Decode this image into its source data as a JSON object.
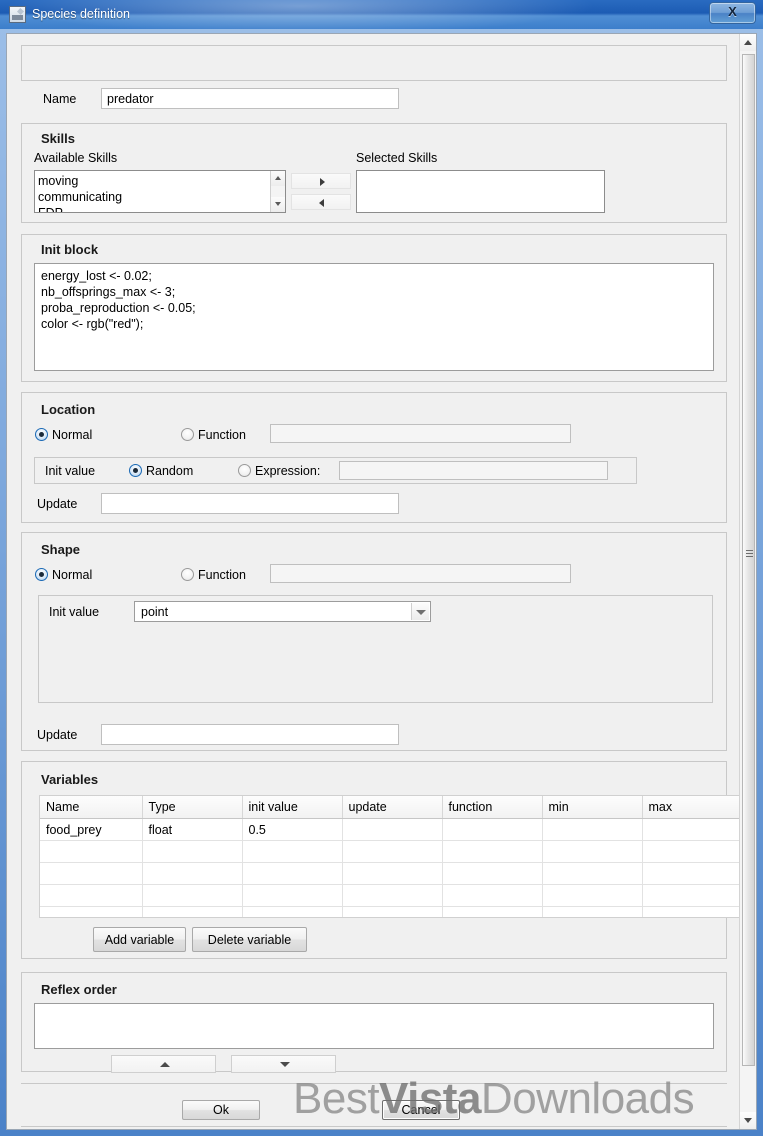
{
  "window": {
    "title": "Species definition",
    "icon": "app-image-icon",
    "close_label": "X",
    "titlebar_color": "#1d5cb4"
  },
  "name_row": {
    "label": "Name",
    "value": "predator"
  },
  "skills": {
    "group_title": "Skills",
    "available_label": "Available Skills",
    "selected_label": "Selected Skills",
    "available_items": [
      "moving",
      "communicating",
      "FDP"
    ],
    "selected_items": [],
    "add_arrow": "▶",
    "remove_arrow": "◀"
  },
  "init_block": {
    "group_title": "Init block",
    "code": "energy_lost <- 0.02;\nnb_offsprings_max <- 3;\nproba_reproduction <- 0.05;\ncolor <- rgb(\"red\");"
  },
  "location": {
    "group_title": "Location",
    "normal_label": "Normal",
    "function_label": "Function",
    "mode": "Normal",
    "function_value": "",
    "init_value_label": "Init value",
    "random_label": "Random",
    "expression_label": "Expression:",
    "init_mode": "Random",
    "expression_value": "",
    "update_label": "Update",
    "update_value": ""
  },
  "shape": {
    "group_title": "Shape",
    "normal_label": "Normal",
    "function_label": "Function",
    "mode": "Normal",
    "function_value": "",
    "init_value_label": "Init value",
    "init_value": "point",
    "init_value_options": [
      "point"
    ],
    "update_label": "Update",
    "update_value": ""
  },
  "variables": {
    "group_title": "Variables",
    "columns": [
      "Name",
      "Type",
      "init value",
      "update",
      "function",
      "min",
      "max"
    ],
    "rows": [
      [
        "food_prey",
        "float",
        "0.5",
        "",
        "",
        "",
        ""
      ],
      [
        "",
        "",
        "",
        "",
        "",
        "",
        ""
      ],
      [
        "",
        "",
        "",
        "",
        "",
        "",
        ""
      ],
      [
        "",
        "",
        "",
        "",
        "",
        "",
        ""
      ],
      [
        "",
        "",
        "",
        "",
        "",
        "",
        ""
      ]
    ],
    "add_button": "Add variable",
    "delete_button": "Delete variable"
  },
  "reflex_order": {
    "group_title": "Reflex order",
    "items": [],
    "move_up_icon": "triangle-up-icon",
    "move_down_icon": "triangle-down-icon"
  },
  "footer": {
    "ok_label": "Ok",
    "cancel_label": "Cancel"
  },
  "watermark": {
    "prefix": "Best",
    "bold": "Vista",
    "suffix": "Downloads"
  }
}
